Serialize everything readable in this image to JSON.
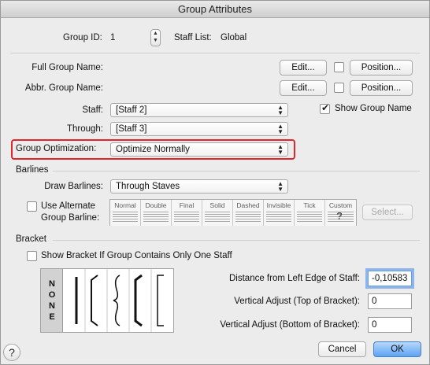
{
  "window": {
    "title": "Group Attributes"
  },
  "group": {
    "id_label": "Group ID:",
    "id_value": "1",
    "staff_list_label": "Staff List:",
    "staff_list_value": "Global"
  },
  "names": {
    "full_label": "Full Group Name:",
    "abbr_label": "Abbr. Group Name:",
    "edit_label": "Edit...",
    "position_label": "Position..."
  },
  "staff": {
    "staff_label": "Staff:",
    "staff_value": "[Staff 2]",
    "through_label": "Through:",
    "through_value": "[Staff 3]",
    "show_group_name_label": "Show Group Name",
    "show_group_name_checked": true
  },
  "optimization": {
    "label": "Group Optimization:",
    "value": "Optimize Normally"
  },
  "barlines": {
    "section_label": "Barlines",
    "draw_label": "Draw Barlines:",
    "draw_value": "Through Staves",
    "alternate_label_1": "Use Alternate",
    "alternate_label_2": "Group Barline:",
    "types": [
      "Normal",
      "Double",
      "Final",
      "Solid",
      "Dashed",
      "Invisible",
      "Tick",
      "Custom"
    ],
    "select_label": "Select..."
  },
  "bracket": {
    "section_label": "Bracket",
    "show_if_one_label": "Show Bracket If Group Contains Only One Staff",
    "none_label": "NONE",
    "distance_label": "Distance from Left Edge of Staff:",
    "distance_value": "-0,10583",
    "vtop_label": "Vertical Adjust (Top of Bracket):",
    "vtop_value": "0",
    "vbottom_label": "Vertical Adjust (Bottom of Bracket):",
    "vbottom_value": "0"
  },
  "footer": {
    "help_label": "?",
    "cancel_label": "Cancel",
    "ok_label": "OK"
  }
}
